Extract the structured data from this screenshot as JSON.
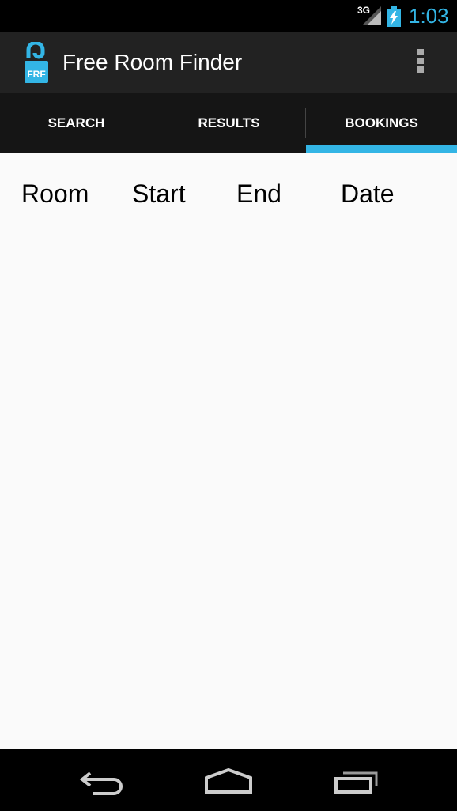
{
  "status_bar": {
    "network": "3G",
    "time": "1:03",
    "accent_color": "#33b5e5"
  },
  "action_bar": {
    "title": "Free Room Finder",
    "icon_text": "FRF",
    "icon": "door-hanger-icon",
    "overflow_icon": "overflow-menu-icon"
  },
  "tabs": [
    {
      "label": "SEARCH",
      "selected": false
    },
    {
      "label": "RESULTS",
      "selected": false
    },
    {
      "label": "BOOKINGS",
      "selected": true
    }
  ],
  "bookings_table": {
    "columns": [
      "Room",
      "Start",
      "End",
      "Date"
    ]
  },
  "nav_bar": {
    "icons": [
      "back-icon",
      "home-icon",
      "recent-apps-icon"
    ]
  }
}
